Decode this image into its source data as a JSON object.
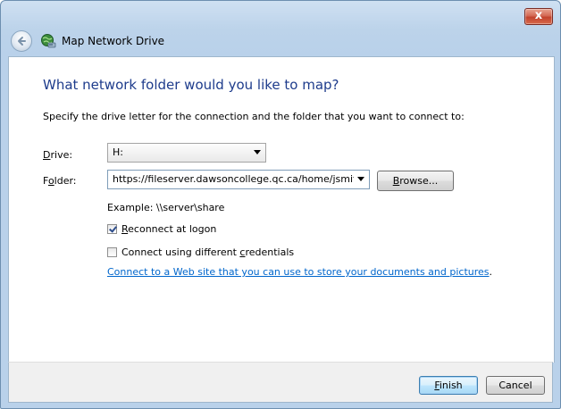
{
  "window": {
    "title": "Map Network Drive",
    "close_glyph": "x"
  },
  "main": {
    "heading": "What network folder would you like to map?",
    "description": "Specify the drive letter for the connection and the folder that you want to connect to:",
    "drive": {
      "label_key": "D",
      "label_rest": "rive:",
      "value": "H:"
    },
    "folder": {
      "label_pre": "F",
      "label_key": "o",
      "label_rest": "lder:",
      "value": "https://fileserver.dawsoncollege.qc.ca/home/jsmit"
    },
    "browse": {
      "label_key": "B",
      "label_rest": "rowse..."
    },
    "example": "Example: \\\\server\\share",
    "reconnect": {
      "label_key": "R",
      "label_rest": "econnect at logon",
      "checked": true
    },
    "credentials": {
      "label_pre": "Connect using different ",
      "label_key": "c",
      "label_rest": "redentials",
      "checked": false
    },
    "web_link": {
      "text": "Connect to a Web site that you can use to store your documents and pictures",
      "suffix": "."
    }
  },
  "footer": {
    "finish": {
      "label_key": "F",
      "label_rest": "inish"
    },
    "cancel": "Cancel"
  },
  "icons": {
    "back": "back-arrow-icon",
    "app": "network-drive-icon",
    "close": "close-icon"
  },
  "colors": {
    "heading": "#1e3c8c",
    "link": "#0066cc",
    "close_red": "#c2432d"
  }
}
